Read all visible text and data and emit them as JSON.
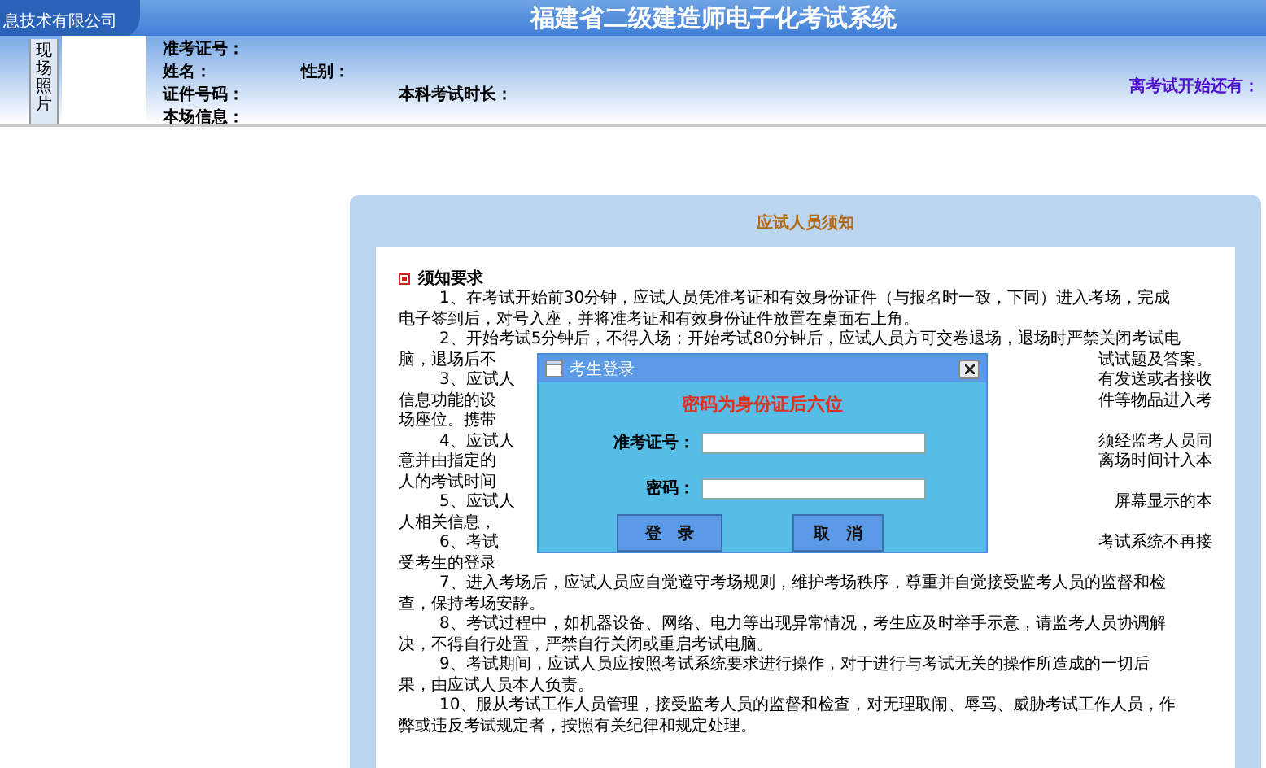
{
  "header": {
    "company": "息技术有限公司",
    "title": "福建省二级建造师电子化考试系统"
  },
  "candidate": {
    "photo_label": "现场照片",
    "fields": [
      {
        "label": "准考证号："
      },
      {
        "label": "姓名："
      },
      {
        "label": "性别："
      },
      {
        "label": "证件号码："
      },
      {
        "label": "本科考试时长："
      },
      {
        "label": "本场信息："
      }
    ],
    "countdown": "离考试开始还有："
  },
  "notice": {
    "title": "应试人员须知",
    "heading": "须知要求",
    "paragraphs": [
      {
        "lines": [
          [
            "1、在考试开始前30分钟，应试人员凭准考证和有效身份证件（与报名时一致，下同）进入考场，完成"
          ],
          [
            "电子签到后，对号入座，并将准考证和有效身份证件放置在桌面右上角。"
          ]
        ]
      },
      {
        "lines": [
          [
            "2、开始考试5分钟后，不得入场；开始考试80分钟后，应试人员方可交卷退场，退场时严禁关闭考试电"
          ],
          [
            "脑，退场后不",
            "试试题及答案。"
          ]
        ]
      },
      {
        "lines": [
          [
            "3、应试人",
            "有发送或者接收"
          ],
          [
            "信息功能的设",
            "件等物品进入考"
          ],
          [
            "场座位。携带"
          ]
        ]
      },
      {
        "lines": [
          [
            "4、应试人",
            "须经监考人员同"
          ],
          [
            "意并由指定的",
            "离场时间计入本"
          ],
          [
            "人的考试时间"
          ]
        ]
      },
      {
        "lines": [
          [
            "5、应试人",
            "屏幕显示的本"
          ],
          [
            "人相关信息，"
          ]
        ]
      },
      {
        "lines": [
          [
            "6、考试",
            "考试系统不再接"
          ],
          [
            "受考生的登录"
          ]
        ]
      },
      {
        "lines": [
          [
            "7、进入考场后，应试人员应自觉遵守考场规则，维护考场秩序，尊重并自觉接受监考人员的监督和检"
          ],
          [
            "查，保持考场安静。"
          ]
        ]
      },
      {
        "lines": [
          [
            "8、考试过程中，如机器设备、网络、电力等出现异常情况，考生应及时举手示意，请监考人员协调解"
          ],
          [
            "决，不得自行处置，严禁自行关闭或重启考试电脑。"
          ]
        ]
      },
      {
        "lines": [
          [
            "9、考试期间，应试人员应按照考试系统要求进行操作，对于进行与考试无关的操作所造成的一切后"
          ],
          [
            "果，由应试人员本人负责。"
          ]
        ]
      },
      {
        "lines": [
          [
            "10、服从考试工作人员管理，接受监考人员的监督和检查，对无理取闹、辱骂、威胁考试工作人员，作"
          ],
          [
            "弊或违反考试规定者，按照有关纪律和规定处理。"
          ]
        ]
      }
    ]
  },
  "login_dialog": {
    "title": "考生登录",
    "hint": "密码为身份证后六位",
    "fields": [
      {
        "label": "准考证号："
      },
      {
        "label": "密码："
      }
    ],
    "buttons": [
      "登　录",
      "取　消"
    ]
  }
}
